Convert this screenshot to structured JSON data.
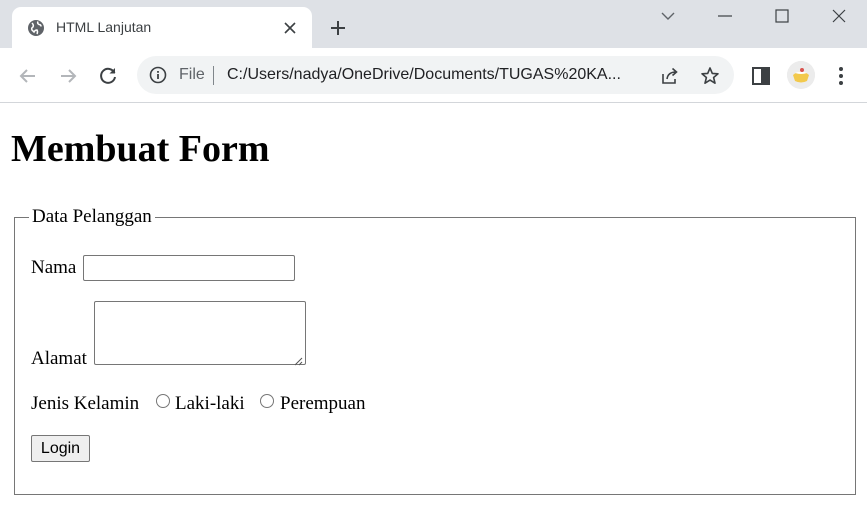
{
  "browser": {
    "tab_title": "HTML Lanjutan",
    "address_scheme_label": "File",
    "url": "C:/Users/nadya/OneDrive/Documents/TUGAS%20KA..."
  },
  "icons": {
    "tab_favicon": "globe-icon",
    "tab_close": "close-icon",
    "new_tab": "plus-icon",
    "window": [
      "chevron-down-icon",
      "minimize-icon",
      "maximize-icon",
      "close-icon"
    ],
    "nav": [
      "back-arrow-icon",
      "forward-arrow-icon",
      "reload-icon"
    ],
    "omnibox": [
      "info-icon",
      "share-icon",
      "star-icon"
    ],
    "toolbar_right": [
      "side-panel-icon",
      "avatar",
      "kebab-menu-icon"
    ]
  },
  "page": {
    "heading": "Membuat Form",
    "form": {
      "legend": "Data Pelanggan",
      "nama_label": "Nama",
      "nama_value": "",
      "alamat_label": "Alamat",
      "alamat_value": "",
      "gender_label": "Jenis Kelamin",
      "gender_options": [
        {
          "label": "Laki-laki",
          "checked": false
        },
        {
          "label": "Perempuan",
          "checked": false
        }
      ],
      "submit_label": "Login"
    }
  },
  "colors": {
    "tabbar_bg": "#dee1e6",
    "omnibox_bg": "#f1f3f4",
    "border": "#767676"
  }
}
